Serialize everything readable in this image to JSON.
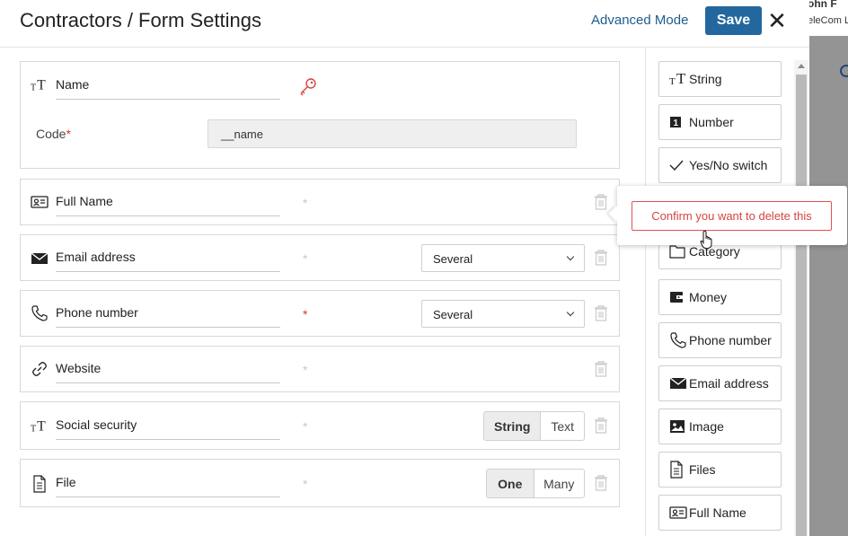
{
  "background": {
    "user_name": "ohn F",
    "company": "eleCom L"
  },
  "header": {
    "title": "Contractors / Form Settings",
    "advanced_mode_label": "Advanced Mode",
    "save_label": "Save",
    "close_glyph": "✕"
  },
  "fields": [
    {
      "name": "Name",
      "icon": "text-icon",
      "code_label": "Code",
      "code_required_mark": "*",
      "code_value": "__name"
    },
    {
      "name": "Full Name",
      "icon": "id-card-icon",
      "required": false
    },
    {
      "name": "Email address",
      "icon": "envelope-icon",
      "required": false,
      "select_value": "Several"
    },
    {
      "name": "Phone number",
      "icon": "phone-icon",
      "required": true,
      "select_value": "Several"
    },
    {
      "name": "Website",
      "icon": "link-icon",
      "required": false
    },
    {
      "name": "Social security",
      "icon": "text-icon",
      "required": false,
      "segment": [
        "String",
        "Text"
      ]
    },
    {
      "name": "File",
      "icon": "file-icon",
      "required": false,
      "segment": [
        "One",
        "Many"
      ]
    }
  ],
  "required_glyph": "*",
  "palette": [
    {
      "label": "String",
      "icon": "text-icon"
    },
    {
      "label": "Number",
      "icon": "number-icon"
    },
    {
      "label": "Yes/No switch",
      "icon": "check-icon"
    },
    {
      "label": "Category",
      "icon": "folder-icon"
    },
    {
      "label": "Money",
      "icon": "wallet-icon"
    },
    {
      "label": "Phone number",
      "icon": "phone-icon"
    },
    {
      "label": "Email address",
      "icon": "envelope-icon"
    },
    {
      "label": "Image",
      "icon": "image-icon"
    },
    {
      "label": "Files",
      "icon": "file-icon"
    },
    {
      "label": "Full Name",
      "icon": "id-card-icon"
    }
  ],
  "popover": {
    "confirm_label": "Confirm you want to delete this"
  },
  "colors": {
    "accent": "#23679e",
    "link": "#1e5b8e",
    "danger": "#d84343"
  }
}
